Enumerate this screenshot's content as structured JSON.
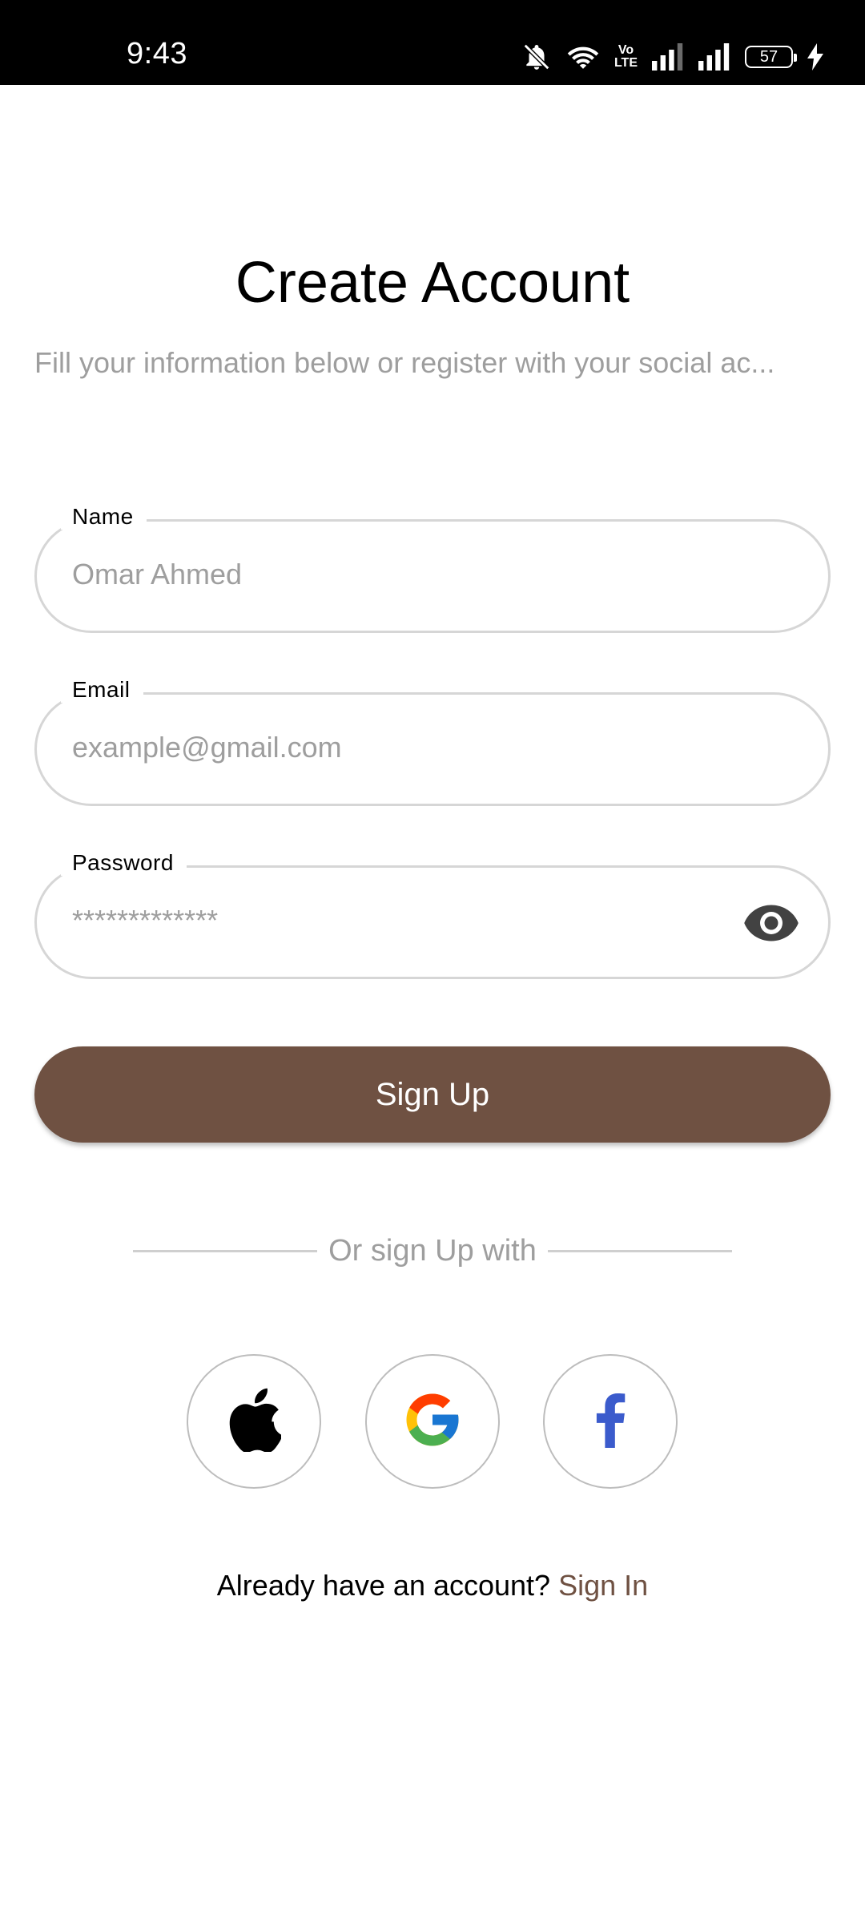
{
  "status_bar": {
    "time": "9:43",
    "volte_line1": "Vo",
    "volte_line2": "LTE",
    "battery_level": "57",
    "icons": [
      "bell-off-icon",
      "wifi-icon",
      "volte-icon",
      "signal-icon",
      "signal-icon",
      "battery-icon",
      "charging-icon"
    ]
  },
  "header": {
    "title": "Create Account",
    "subtitle": "Fill your information below or register with your social ac..."
  },
  "form": {
    "name": {
      "label": "Name",
      "placeholder": "Omar Ahmed"
    },
    "email": {
      "label": "Email",
      "placeholder": "example@gmail.com"
    },
    "password": {
      "label": "Password",
      "placeholder": "*************",
      "toggle_icon": "eye-icon"
    },
    "submit_label": "Sign Up"
  },
  "social": {
    "divider_text": "Or sign Up with",
    "providers": [
      "apple-icon",
      "google-icon",
      "facebook-icon"
    ]
  },
  "footer": {
    "prompt": "Already have an account?",
    "link": "Sign In"
  },
  "colors": {
    "primary": "#6f5142",
    "muted_text": "#9e9e9e",
    "field_border": "#d6d6d6",
    "facebook_blue": "#3b5bcc"
  }
}
